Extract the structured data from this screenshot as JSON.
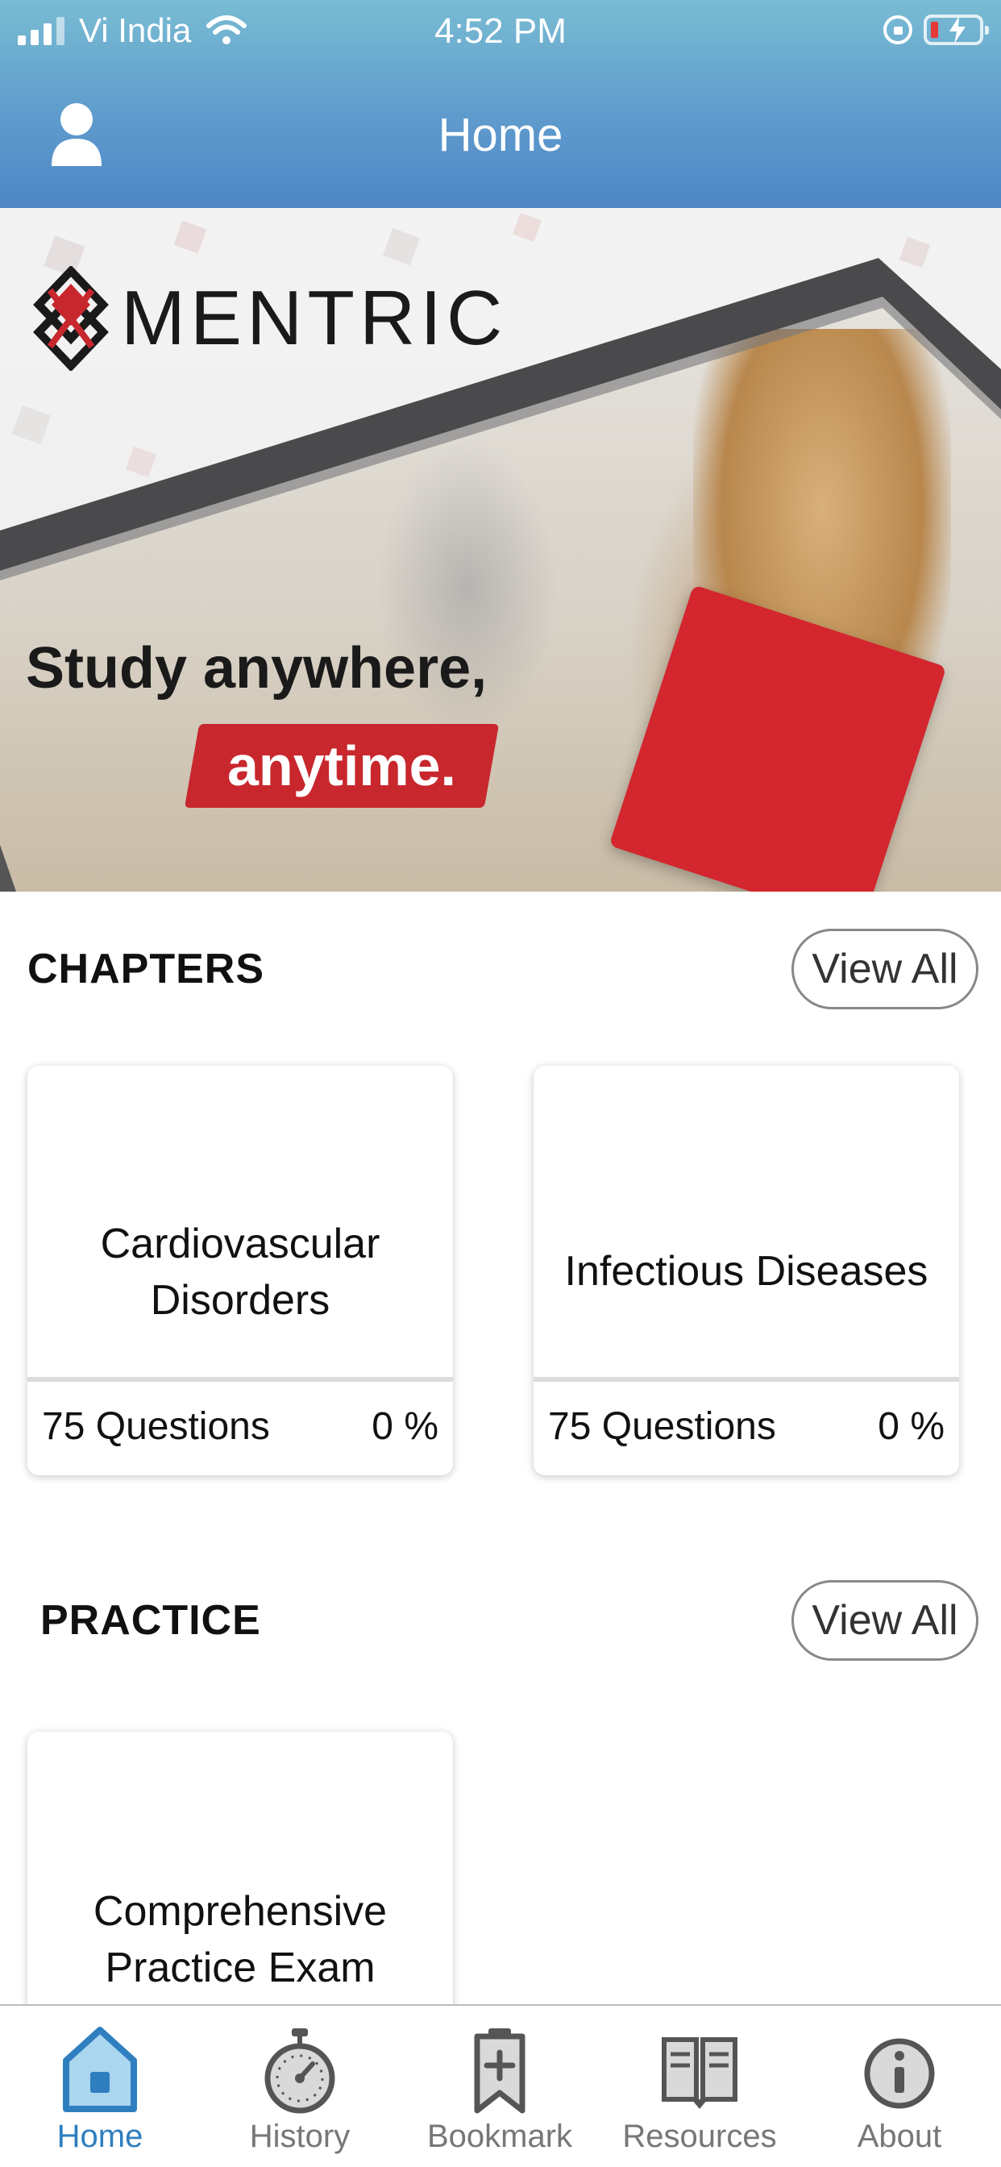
{
  "status_bar": {
    "carrier": "Vi India",
    "time": "4:52 PM"
  },
  "header": {
    "title": "Home",
    "profile_icon": "user-icon"
  },
  "banner": {
    "logo_text": "MENTRIC",
    "tagline_line1": "Study anywhere,",
    "tagline_line2": "anytime.",
    "accent_color": "#c8272e"
  },
  "chapters": {
    "title": "CHAPTERS",
    "view_all": "View All",
    "cards": [
      {
        "title_line1": "Cardiovascular",
        "title_line2": "Disorders",
        "questions": "75 Questions",
        "percent": "0 %"
      },
      {
        "title_line1": "Infectious Diseases",
        "questions": "75 Questions",
        "percent": "0 %"
      }
    ]
  },
  "practice": {
    "title": "PRACTICE",
    "view_all": "View All",
    "cards": [
      {
        "title_line1": "Comprehensive",
        "title_line2": "Practice Exam"
      }
    ]
  },
  "tabbar": {
    "active_color": "#2f7fbf",
    "items": [
      {
        "label": "Home",
        "icon": "home-icon",
        "active": true
      },
      {
        "label": "History",
        "icon": "stopwatch-icon",
        "active": false
      },
      {
        "label": "Bookmark",
        "icon": "bookmark-icon",
        "active": false
      },
      {
        "label": "Resources",
        "icon": "book-icon",
        "active": false
      },
      {
        "label": "About",
        "icon": "info-icon",
        "active": false
      }
    ]
  }
}
